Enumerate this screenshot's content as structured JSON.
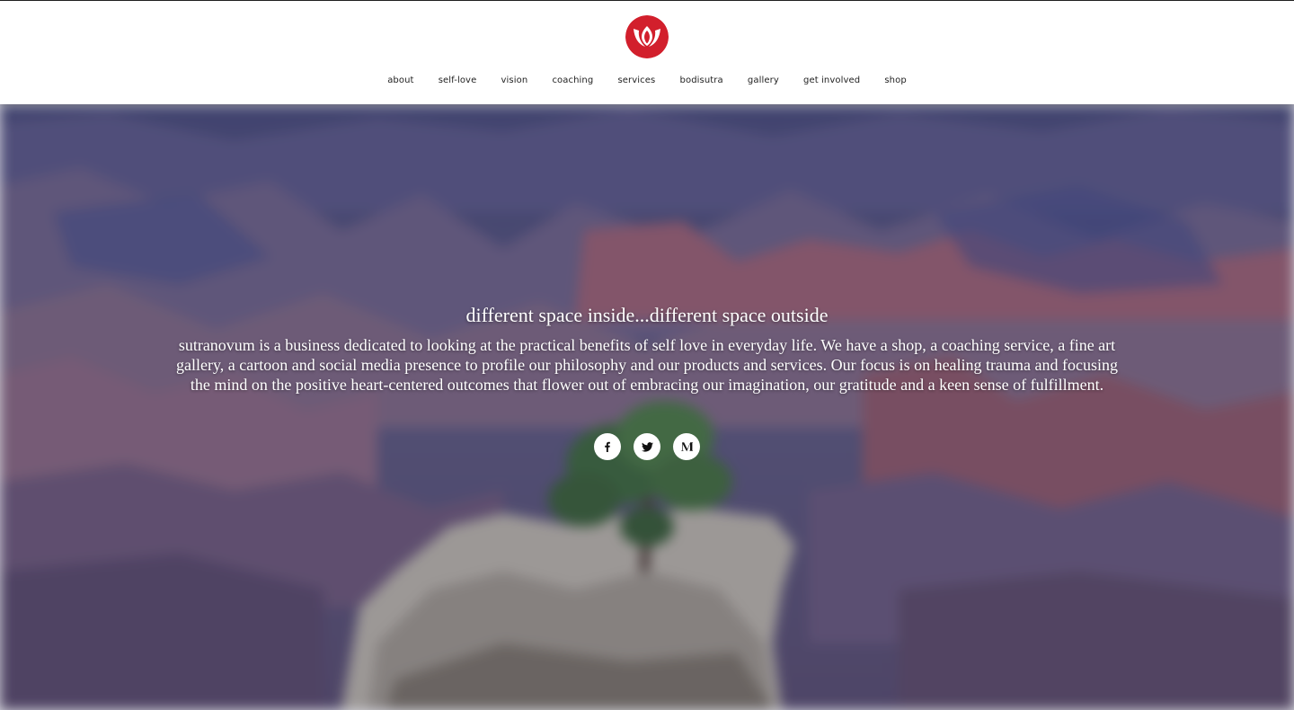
{
  "brand": {
    "logo_icon": "lotus-logo-icon",
    "accent": "#d21f2c"
  },
  "nav": {
    "items": [
      {
        "label": "about"
      },
      {
        "label": "self-love"
      },
      {
        "label": "vision"
      },
      {
        "label": "coaching"
      },
      {
        "label": "services"
      },
      {
        "label": "bodisutra"
      },
      {
        "label": "gallery"
      },
      {
        "label": "get involved"
      },
      {
        "label": "shop"
      }
    ]
  },
  "hero": {
    "background": "grand-canyon-tree-photo",
    "tagline": "different space inside...different space outside",
    "description": "sutranovum is a business dedicated to looking at the practical benefits of self love in everyday life. We have a shop, a coaching service, a fine art gallery, a cartoon and social media presence to profile our philosophy and our products and services. Our focus is on healing trauma and focusing the mind on the positive heart-centered outcomes that flower out of embracing our imagination, our gratitude and a keen sense of fulfillment."
  },
  "social": {
    "links": [
      {
        "icon": "facebook-icon"
      },
      {
        "icon": "twitter-icon"
      },
      {
        "icon": "medium-icon"
      }
    ]
  }
}
